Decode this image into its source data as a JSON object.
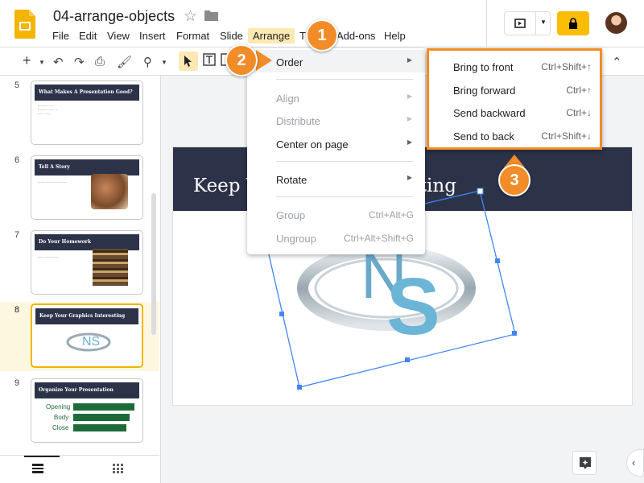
{
  "app": {
    "doc_title": "04-arrange-objects",
    "menu": [
      "File",
      "Edit",
      "View",
      "Insert",
      "Format",
      "Slide",
      "Arrange",
      "Tools",
      "Add-ons",
      "Help"
    ],
    "menu_visible": {
      "file": "File",
      "edit": "Edit",
      "view": "View",
      "insert": "Insert",
      "format": "Format",
      "slide": "Slide",
      "arrange": "Arrange",
      "tools_partial": "T",
      "addons": "Add-ons",
      "help": "Help"
    }
  },
  "toolbar": {
    "icons": [
      "plus-icon",
      "dropdown-icon",
      "undo-icon",
      "redo-icon",
      "print-icon",
      "paint-format-icon",
      "zoom-icon",
      "cursor-icon",
      "textbox-icon"
    ]
  },
  "filmstrip": {
    "slides": [
      {
        "num": "5",
        "title": "What Makes A Presentation Good?"
      },
      {
        "num": "6",
        "title": "Tell A Story"
      },
      {
        "num": "7",
        "title": "Do Your Homework"
      },
      {
        "num": "8",
        "title": "Keep Your Graphics Interesting"
      },
      {
        "num": "9",
        "title": "Organize Your Presentation",
        "rows": [
          "Opening",
          "Body",
          "Close"
        ]
      }
    ]
  },
  "slide": {
    "title_left": "Keep Y",
    "title_right": "sting"
  },
  "arrange_menu": {
    "order": "Order",
    "align": "Align",
    "distribute": "Distribute",
    "center_on_page": "Center on page",
    "rotate": "Rotate",
    "group": "Group",
    "group_shortcut": "Ctrl+Alt+G",
    "ungroup": "Ungroup",
    "ungroup_shortcut": "Ctrl+Alt+Shift+G"
  },
  "order_menu": {
    "items": [
      {
        "label": "Bring to front",
        "shortcut": "Ctrl+Shift+↑"
      },
      {
        "label": "Bring forward",
        "shortcut": "Ctrl+↑"
      },
      {
        "label": "Send backward",
        "shortcut": "Ctrl+↓"
      },
      {
        "label": "Send to back",
        "shortcut": "Ctrl+Shift+↓"
      }
    ]
  },
  "callouts": {
    "one": "1",
    "two": "2",
    "three": "3"
  },
  "colors": {
    "accent": "#f28c28",
    "slide_header": "#2c3349",
    "highlight": "#fce8b2",
    "selection": "#4285f4",
    "thumb_green": "#1e6b3a"
  }
}
